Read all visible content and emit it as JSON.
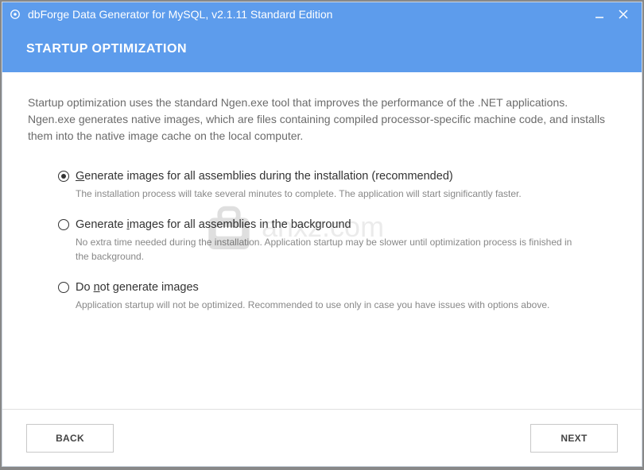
{
  "titlebar": {
    "title": "dbForge Data Generator for MySQL, v2.1.11 Standard Edition"
  },
  "header": {
    "title": "STARTUP OPTIMIZATION"
  },
  "intro": "Startup optimization uses the standard Ngen.exe tool that improves the performance of the .NET applications. Ngen.exe generates native images, which are files containing compiled processor-specific machine code, and installs them into the native image cache on the local computer.",
  "options": [
    {
      "label_pre": "",
      "hotkey": "G",
      "label_post": "enerate images for all assemblies during the installation (recommended)",
      "desc": "The installation process will take several minutes to complete. The application will start significantly faster.",
      "checked": true
    },
    {
      "label_pre": "Generate ",
      "hotkey": "i",
      "label_post": "mages for all assemblies in the background",
      "desc": "No extra time needed during the installation. Application startup may be slower until optimization process is finished in the background.",
      "checked": false
    },
    {
      "label_pre": "Do ",
      "hotkey": "n",
      "label_post": "ot generate images",
      "desc": "Application startup will not be optimized. Recommended to use only in case you have issues with options above.",
      "checked": false
    }
  ],
  "footer": {
    "back": "BACK",
    "next": "NEXT"
  },
  "watermark": "anxz.com"
}
